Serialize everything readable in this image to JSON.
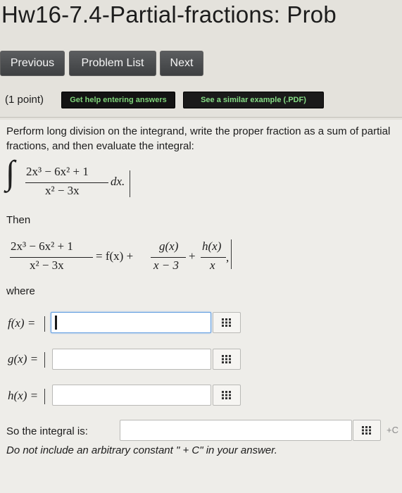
{
  "page": {
    "title": "Hw16-7.4-Partial-fractions: Prob"
  },
  "nav": {
    "previous": "Previous",
    "problem_list": "Problem List",
    "next": "Next"
  },
  "problem": {
    "points": "(1 point)",
    "help_link": "Get help entering answers",
    "example_link": "See a similar example (.PDF)",
    "intro": "Perform long division on the integrand, write the proper fraction as a sum of partial fractions, and then evaluate the integral:",
    "integral": {
      "numerator": "2x³ − 6x² + 1",
      "denominator": "x² − 3x",
      "dx": "dx."
    },
    "then_label": "Then",
    "decomposition": {
      "lhs_numerator": "2x³ − 6x² + 1",
      "lhs_denominator": "x² − 3x",
      "eq_fx": "= f(x) +",
      "g_num": "g(x)",
      "g_den": "x − 3",
      "plus": "+",
      "h_num": "h(x)",
      "h_den": "x",
      "comma": ","
    },
    "where_label": "where",
    "answers": [
      {
        "label": "f(x) =",
        "value": ""
      },
      {
        "label": "g(x) =",
        "value": ""
      },
      {
        "label": "h(x) =",
        "value": ""
      }
    ],
    "integral_prompt": "So the integral is:",
    "integral_answer": "",
    "plus_c": "+C",
    "note": "Do not include an arbitrary constant \" + C\" in your answer."
  }
}
